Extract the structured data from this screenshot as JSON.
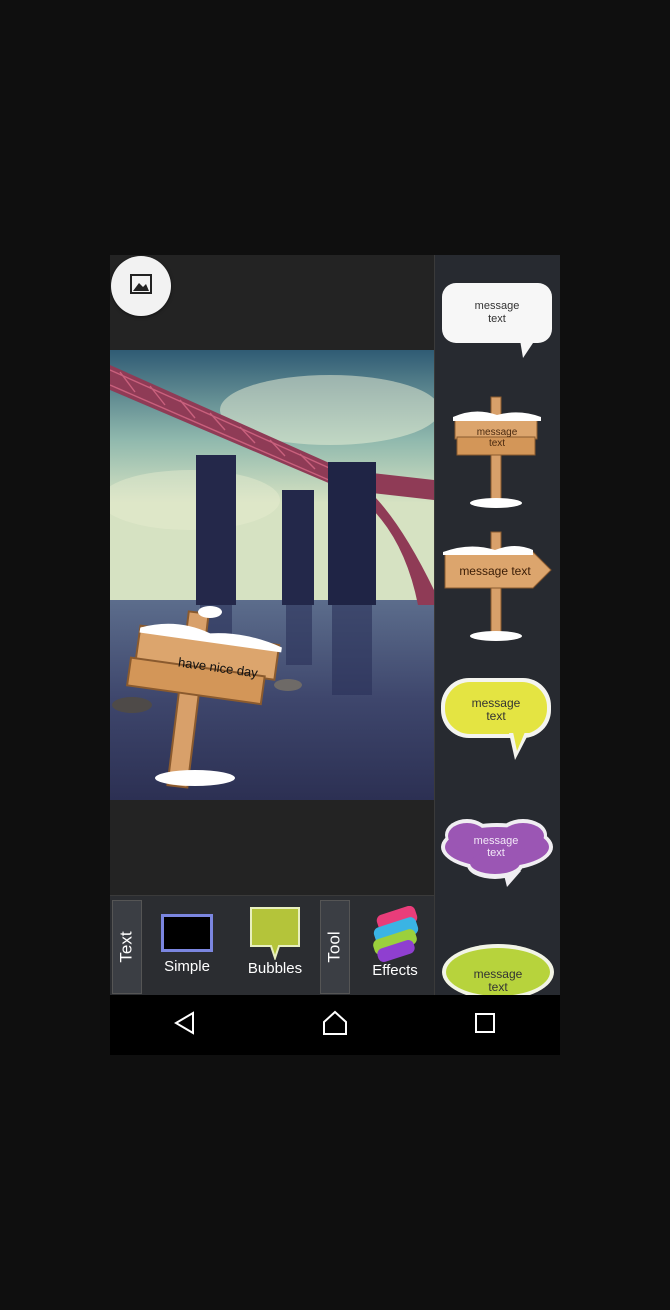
{
  "canvas": {
    "overlay_sign_text": "have nice day"
  },
  "sticker_panel": {
    "stickers": [
      {
        "icon": "white-speech-bubble-icon",
        "text_line1": "message",
        "text_line2": "text"
      },
      {
        "icon": "snowy-wooden-signpost-icon",
        "text_line1": "message",
        "text_line2": "text"
      },
      {
        "icon": "snowy-arrow-signpost-icon",
        "text": "message text"
      },
      {
        "icon": "yellow-speech-bubble-icon",
        "text_line1": "message",
        "text_line2": "text"
      },
      {
        "icon": "purple-cloud-bubble-icon",
        "text_line1": "message",
        "text_line2": "text"
      },
      {
        "icon": "green-cloud-bubble-icon",
        "text_line1": "message",
        "text_line2": "text"
      }
    ]
  },
  "bottom_bar": {
    "text_tab": "Text",
    "simple_label": "Simple",
    "bubbles_label": "Bubbles",
    "tool_tab": "Tool",
    "effects_label": "Effects"
  },
  "navbar": {
    "icons": [
      "back-icon",
      "home-icon",
      "recents-icon"
    ]
  },
  "colors": {
    "panel_bg": "#272a30",
    "simple_border": "#7b86e0",
    "bubbles_green": "#b4c43a"
  }
}
